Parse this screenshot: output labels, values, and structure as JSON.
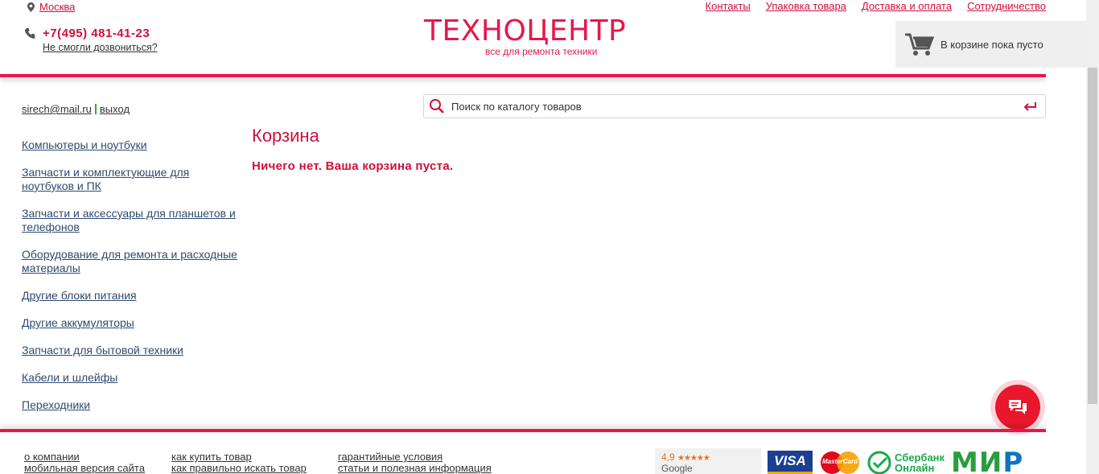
{
  "header": {
    "city": "Москва",
    "nav": [
      "Контакты",
      "Упаковка товара",
      "Доставка и оплата",
      "Сотрудничество"
    ],
    "phone": "+7(495) 481-41-23",
    "callback": "Не смогли дозвониться?",
    "logo_main": "ТЕХНОЦЕНТР",
    "logo_sub": "все для ремонта техники",
    "cart_text": "В корзине пока пусто"
  },
  "user": {
    "email": "sirech@mail.ru",
    "logout": "выход"
  },
  "search": {
    "placeholder": "Поиск по каталогу товаров"
  },
  "sidebar": {
    "items": [
      "Компьютеры и ноутбуки",
      "Запчасти и комплектующие для ноутбуков и ПК",
      "Запчасти и аксессуары для планшетов и телефонов",
      "Оборудование для ремонта и расходные материалы",
      "Другие блоки питания",
      "Другие аккумуляторы",
      "Запчасти для бытовой техники",
      "Кабели и шлейфы",
      "Переходники"
    ]
  },
  "main": {
    "title": "Корзина",
    "empty_message": "Ничего нет. Ваша корзина пуста."
  },
  "footer": {
    "col1": [
      "о компании",
      "мобильная версия сайта"
    ],
    "col2": [
      "как купить товар",
      "как правильно искать товар"
    ],
    "col3": [
      "гарантийные условия",
      "статьи и полезная информация"
    ],
    "google_rating": "4,9",
    "google_stars": "★★★★★",
    "google_label": "Google",
    "visa": "VISA",
    "mastercard": "MasterCard",
    "sber_line1": "Сбербанк",
    "sber_line2": "Онлайн",
    "mir_1": "МИ",
    "mir_2": "Р"
  },
  "colors": {
    "accent": "#e8174b",
    "link": "#2e4a6e",
    "cart_bg": "#efefef"
  }
}
